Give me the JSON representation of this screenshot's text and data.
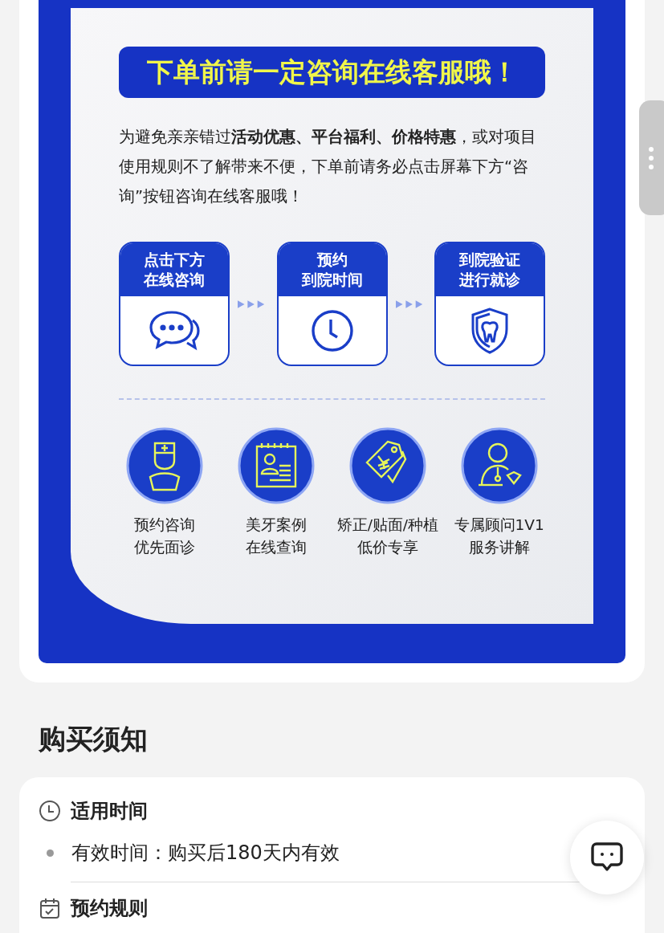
{
  "poster": {
    "banner": "下单前请一定咨询在线客服哦！",
    "notice": "为避免亲亲错过**活动优惠、平台福利、价格特惠**，或对项目使用规则不了解带来不便，下单前请务必点击屏幕下方“咨询”按钮咨询在线客服哦！",
    "steps": [
      {
        "kind": "chat",
        "lines": [
          "点击下方",
          "在线咨询"
        ]
      },
      {
        "kind": "clock",
        "lines": [
          "预约",
          "到院时间"
        ]
      },
      {
        "kind": "tooth-shield",
        "lines": [
          "到院验证",
          "进行就诊"
        ]
      }
    ],
    "benefits": [
      {
        "kind": "doctor",
        "lines": [
          "预约咨询",
          "优先面诊"
        ]
      },
      {
        "kind": "case",
        "lines": [
          "美牙案例",
          "在线查询"
        ]
      },
      {
        "kind": "tag",
        "lines": [
          "矫正/贴面/种植",
          "低价专享"
        ]
      },
      {
        "kind": "advisor",
        "lines": [
          "专属顾问1V1",
          "服务讲解"
        ]
      }
    ]
  },
  "purchase_notes": {
    "title": "购买须知",
    "sections": [
      {
        "kind": "clock",
        "title": "适用时间",
        "items": [
          "有效时间：购买后180天内有效"
        ]
      },
      {
        "kind": "calendar",
        "title": "预约规则"
      }
    ]
  }
}
